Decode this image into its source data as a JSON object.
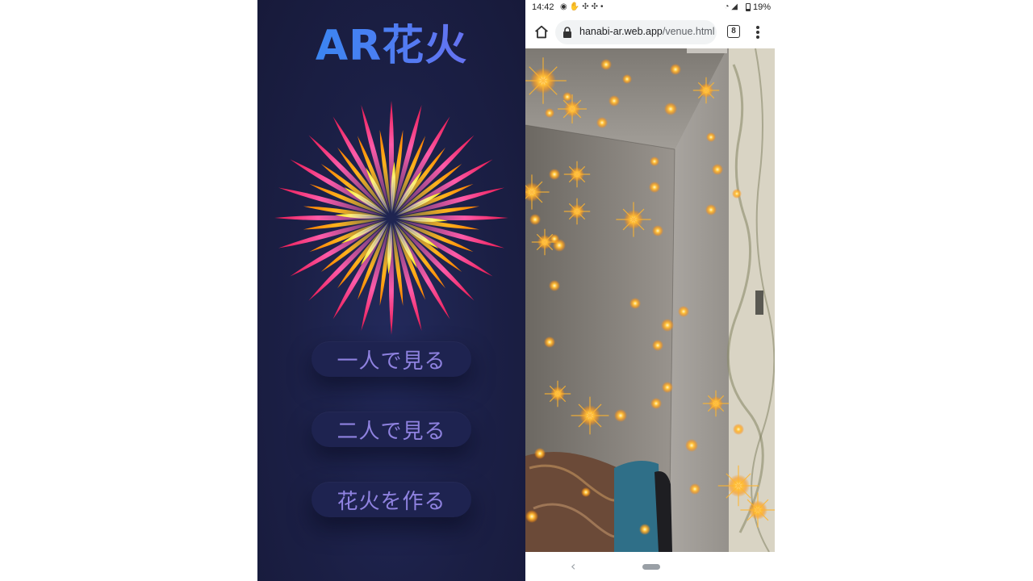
{
  "app": {
    "title": "AR花火",
    "logo_icon": "firework-burst-icon",
    "buttons": {
      "solo": "一人で見る",
      "pair": "二人で見る",
      "create": "花火を作る"
    },
    "colors": {
      "background": "#1b1f45",
      "button_text": "#8f82e0",
      "title_gradient_start": "#2d8cf0",
      "title_gradient_end": "#7a6af0"
    }
  },
  "phone": {
    "status_bar": {
      "time": "14:42",
      "left_icons": [
        "line-icon",
        "hand-icon",
        "slack-icon",
        "slack-icon",
        "dot-icon"
      ],
      "right_icons": [
        "wifi-icon",
        "signal-icon",
        "battery-icon"
      ],
      "battery": "19%"
    },
    "browser": {
      "home_icon": "home-icon",
      "lock_icon": "lock-icon",
      "url_host": "hanabi-ar.web.app",
      "url_path": "/venue.html",
      "tab_count": "8",
      "menu_icon": "more-vert-icon"
    },
    "camera": {
      "scene": "ar-room-with-sparkles"
    },
    "nav": {
      "back_icon": "back-chevron-icon",
      "back_glyph": "‹",
      "home_icon": "home-pill-icon"
    }
  }
}
